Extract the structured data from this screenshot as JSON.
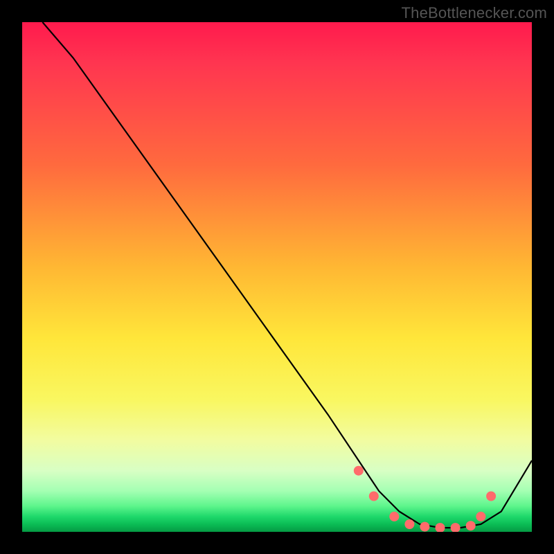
{
  "watermark": "TheBottlenecker.com",
  "chart_data": {
    "type": "line",
    "title": "",
    "xlabel": "",
    "ylabel": "",
    "xlim": [
      0,
      100
    ],
    "ylim": [
      0,
      100
    ],
    "series": [
      {
        "name": "curve",
        "x": [
          4,
          10,
          20,
          30,
          40,
          50,
          60,
          66,
          70,
          74,
          78,
          82,
          86,
          90,
          94,
          100
        ],
        "values": [
          100,
          93,
          79,
          65,
          51,
          37,
          23,
          14,
          8,
          4,
          1.5,
          0.8,
          0.8,
          1.5,
          4,
          14
        ]
      }
    ],
    "markers": {
      "x": [
        66,
        69,
        73,
        76,
        79,
        82,
        85,
        88,
        90,
        92
      ],
      "values": [
        12,
        7,
        3,
        1.5,
        1,
        0.8,
        0.8,
        1.2,
        3,
        7
      ],
      "color": "#ff6b6b",
      "radius_px": 7
    },
    "gradient_stops": [
      {
        "pos": 0.0,
        "color": "#ff1a4d"
      },
      {
        "pos": 0.28,
        "color": "#ff6a3e"
      },
      {
        "pos": 0.62,
        "color": "#ffe63a"
      },
      {
        "pos": 0.88,
        "color": "#d8ffc4"
      },
      {
        "pos": 1.0,
        "color": "#059a44"
      }
    ]
  }
}
